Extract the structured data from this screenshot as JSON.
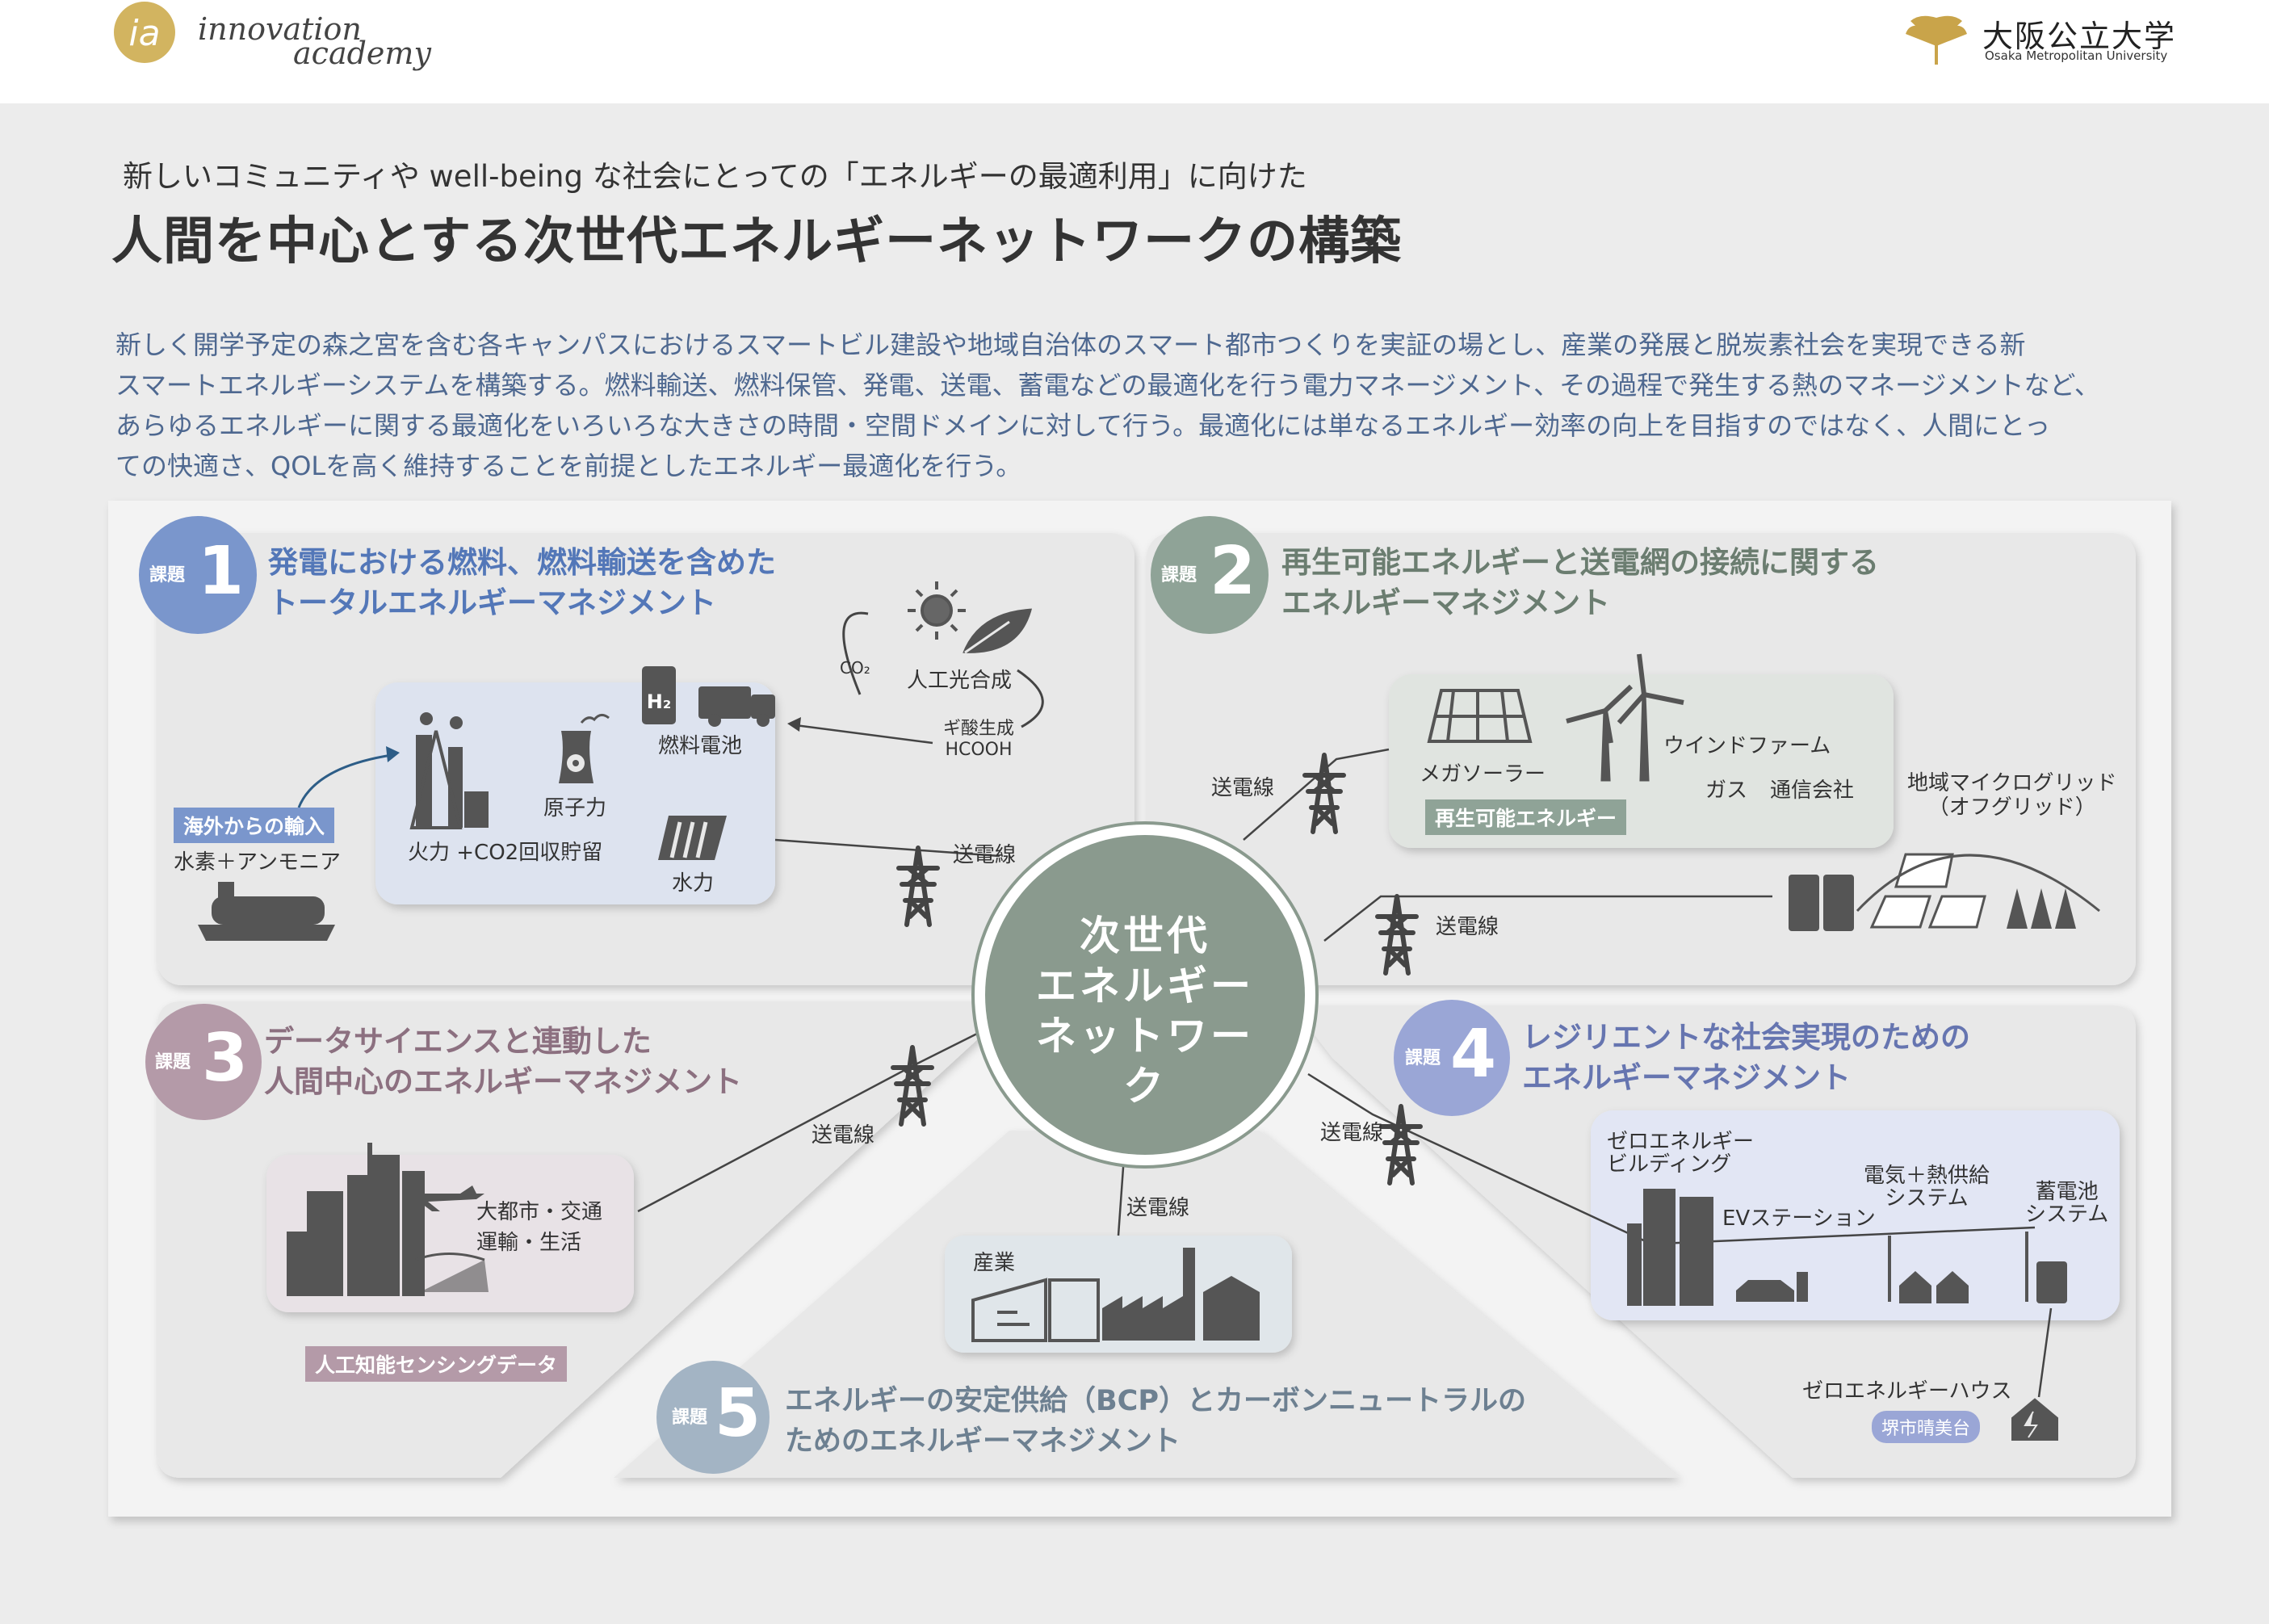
{
  "header": {
    "logo_mark": "ia",
    "logo_line1": "innovation",
    "logo_line2": "academy",
    "university_name": "大阪公立大学",
    "university_en": "Osaka Metropolitan University"
  },
  "subtitle": "新しいコミュニティや well-being な社会にとっての「エネルギーの最適利用」に向けた",
  "title": "人間を中心とする次世代エネルギーネットワークの構築",
  "intro": [
    "新しく開学予定の森之宮を含む各キャンパスにおけるスマートビル建設や地域自治体のスマート都市つくりを実証の場とし、産業の発展と脱炭素社会を実現できる新",
    "スマートエネルギーシステムを構築する。燃料輸送、燃料保管、発電、送電、蓄電などの最適化を行う電力マネージメント、その過程で発生する熱のマネージメントなど、",
    "あらゆるエネルギーに関する最適化をいろいろな大きさの時間・空間ドメインに対して行う。最適化には単なるエネルギー効率の向上を目指すのではなく、人間にとっ",
    "ての快適さ、QOLを高く維持することを前提としたエネルギー最適化を行う。"
  ],
  "colors": {
    "p1": "#7a96cc",
    "p2": "#8fa397",
    "p3": "#b49aa8",
    "p4": "#9aa6d6",
    "p5": "#a3b4c4",
    "center": "#8a9a8e",
    "intro": "#4e6890",
    "icon": "#555555"
  },
  "badge_label": "課題",
  "center": {
    "lines": [
      "次世代",
      "エネルギー",
      "ネットワーク"
    ]
  },
  "panels": {
    "p1": {
      "num": "1",
      "title": [
        "発電における燃料、燃料輸送を含めた",
        "トータルエネルギーマネジメント"
      ],
      "co2": "CO₂",
      "photosynthesis": "人工光合成",
      "formic": [
        "ギ酸生成",
        "HCOOH"
      ],
      "fuel_cell": "燃料電池",
      "nuclear": "原子力",
      "thermal": "火力 +CO2回収貯留",
      "hydro": "水力",
      "import_tag": "海外からの輸入",
      "import_items": "水素＋アンモニア",
      "h2": "H₂"
    },
    "p2": {
      "num": "2",
      "title": [
        "再生可能エネルギーと送電網の接続に関する",
        "エネルギーマネジメント"
      ],
      "mega_solar": "メガソーラー",
      "wind": "ウインドファーム",
      "gas": "ガス",
      "telecom": "通信会社",
      "renew_tag": "再生可能エネルギー",
      "microgrid": [
        "地域マイクログリッド",
        "（オフグリッド）"
      ]
    },
    "p3": {
      "num": "3",
      "title": [
        "データサイエンスと連動した",
        "人間中心のエネルギーマネジメント"
      ],
      "city": [
        "大都市・交通",
        "運輸・生活"
      ],
      "ai_tag": "人工知能センシングデータ"
    },
    "p4": {
      "num": "4",
      "title": [
        "レジリエントな社会実現のための",
        "エネルギーマネジメント"
      ],
      "zeb": [
        "ゼロエネルギー",
        "ビルディング"
      ],
      "ev": "EVステーション",
      "chp": [
        "電気＋熱供給",
        "システム"
      ],
      "battery": [
        "蓄電池",
        "システム"
      ],
      "zeh": "ゼロエネルギーハウス",
      "sakai_tag": "堺市晴美台"
    },
    "p5": {
      "num": "5",
      "title": [
        "エネルギーの安定供給（BCP）とカーボンニュートラルの",
        "ためのエネルギーマネジメント"
      ],
      "industry": "産業"
    }
  },
  "power_line": "送電線"
}
